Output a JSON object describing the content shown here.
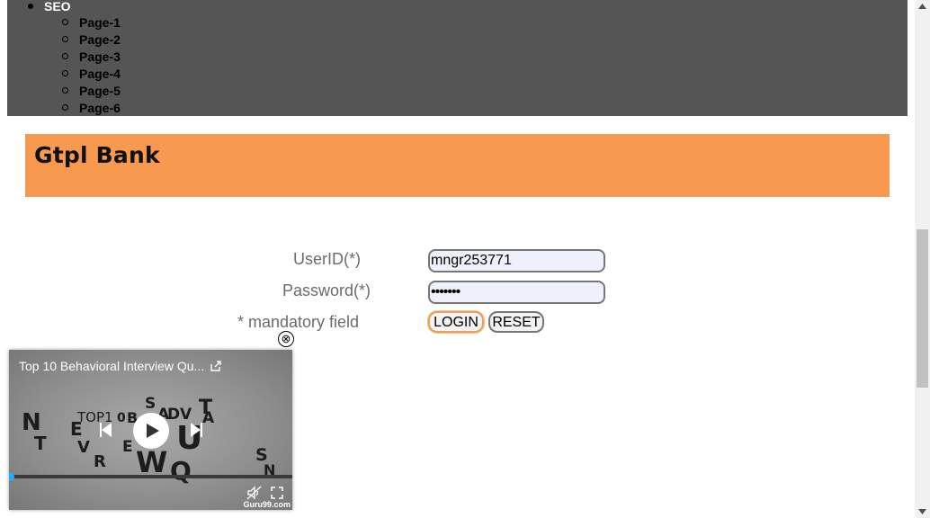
{
  "nav": {
    "top_item": "SEO",
    "sub_items": [
      "Page-1",
      "Page-2",
      "Page-3",
      "Page-4",
      "Page-5",
      "Page-6"
    ]
  },
  "brand": {
    "title": "Gtpl Bank"
  },
  "form": {
    "userid_label": "UserID(*)",
    "userid_value": "mngr253771",
    "password_label": "Password(*)",
    "password_masked": "•••••••",
    "mandatory_note": "* mandatory field",
    "login_label": "LOGIN",
    "reset_label": "RESET"
  },
  "video": {
    "title": "Top 10 Behavioral Interview Qu...",
    "watermark": "Guru99.com",
    "close_glyph": "⊗",
    "thumbnail_letters": [
      "N",
      "T",
      "E",
      "TOP1",
      "0",
      "B",
      "S",
      "A",
      "D",
      "V",
      "T",
      "A",
      "U",
      "V",
      "R",
      "E",
      "W",
      "Q",
      "S",
      "N"
    ],
    "progress": 0.0
  },
  "icons": [
    "share-icon",
    "play-icon",
    "previous-icon",
    "next-icon",
    "mute-icon",
    "fullscreen-icon",
    "close-icon"
  ],
  "colors": {
    "nav_bg": "#555555",
    "brand_bg": "#f79a50",
    "field_bg": "#eef0fb",
    "progress_knob": "#29a9ff"
  }
}
